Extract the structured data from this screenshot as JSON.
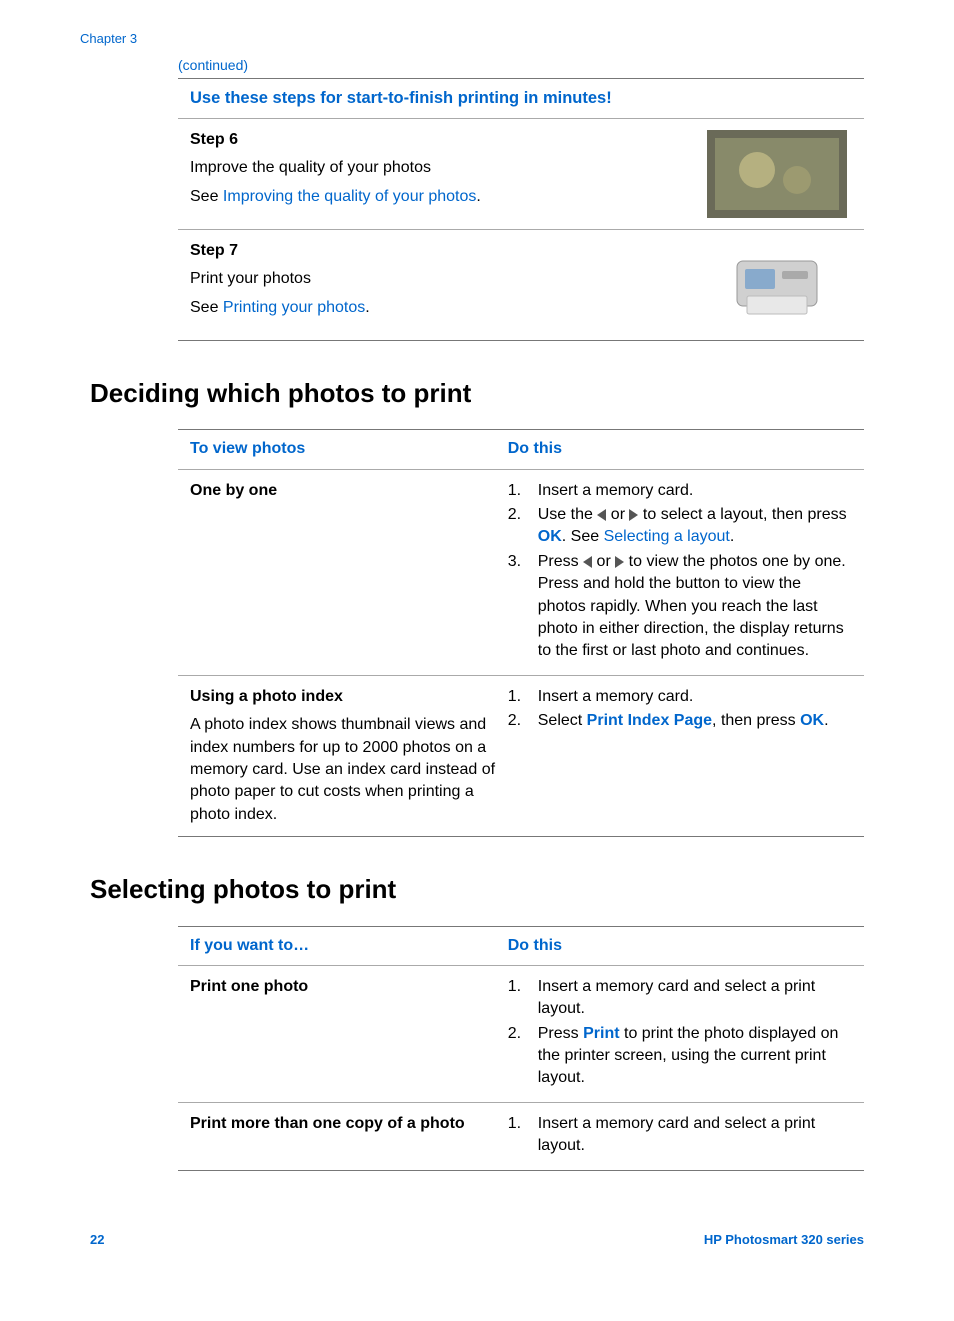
{
  "chapter_link": "Chapter 3",
  "continued": "(continued)",
  "steps": {
    "header": "Use these steps for start-to-finish printing in minutes!",
    "items": [
      {
        "title": "Step 6",
        "desc": "Improve the quality of your photos",
        "see_prefix": "See ",
        "see_link": "Improving the quality of your photos",
        "see_suffix": "."
      },
      {
        "title": "Step 7",
        "desc": "Print your photos",
        "see_prefix": "See ",
        "see_link": "Printing your photos",
        "see_suffix": "."
      }
    ]
  },
  "heading_deciding": "Deciding which photos to print",
  "table1": {
    "col1": "To view photos",
    "col2": "Do this",
    "r1": {
      "title": "One by one",
      "li1": "Insert a memory card.",
      "li2a": "Use the ",
      "li2b": " or ",
      "li2c": " to select a layout, then press ",
      "li2_ok": "OK",
      "li2d": ". See ",
      "li2_link": "Selecting a layout",
      "li2e": ".",
      "li3a": "Press ",
      "li3b": " or ",
      "li3c": " to view the photos one by one. Press and hold the button to view the photos rapidly. When you reach the last photo in either direction, the display returns to the first or last photo and continues."
    },
    "r2": {
      "title": "Using a photo index",
      "desc": "A photo index shows thumbnail views and index numbers for up to 2000 photos on a memory card. Use an index card instead of photo paper to cut costs when printing a photo index.",
      "li1": "Insert a memory card.",
      "li2a": "Select ",
      "li2_kw": "Print Index Page",
      "li2b": ", then press ",
      "li2_ok": "OK",
      "li2c": "."
    }
  },
  "heading_selecting": "Selecting photos to print",
  "table2": {
    "col1": "If you want to…",
    "col2": "Do this",
    "r1": {
      "title": "Print one photo",
      "li1": "Insert a memory card and select a print layout.",
      "li2a": "Press ",
      "li2_kw": "Print",
      "li2b": " to print the photo displayed on the printer screen, using the current print layout."
    },
    "r2": {
      "title": "Print more than one copy of a photo",
      "li1": "Insert a memory card and select a print layout."
    }
  },
  "footer": {
    "page": "22",
    "product": "HP Photosmart 320 series"
  }
}
